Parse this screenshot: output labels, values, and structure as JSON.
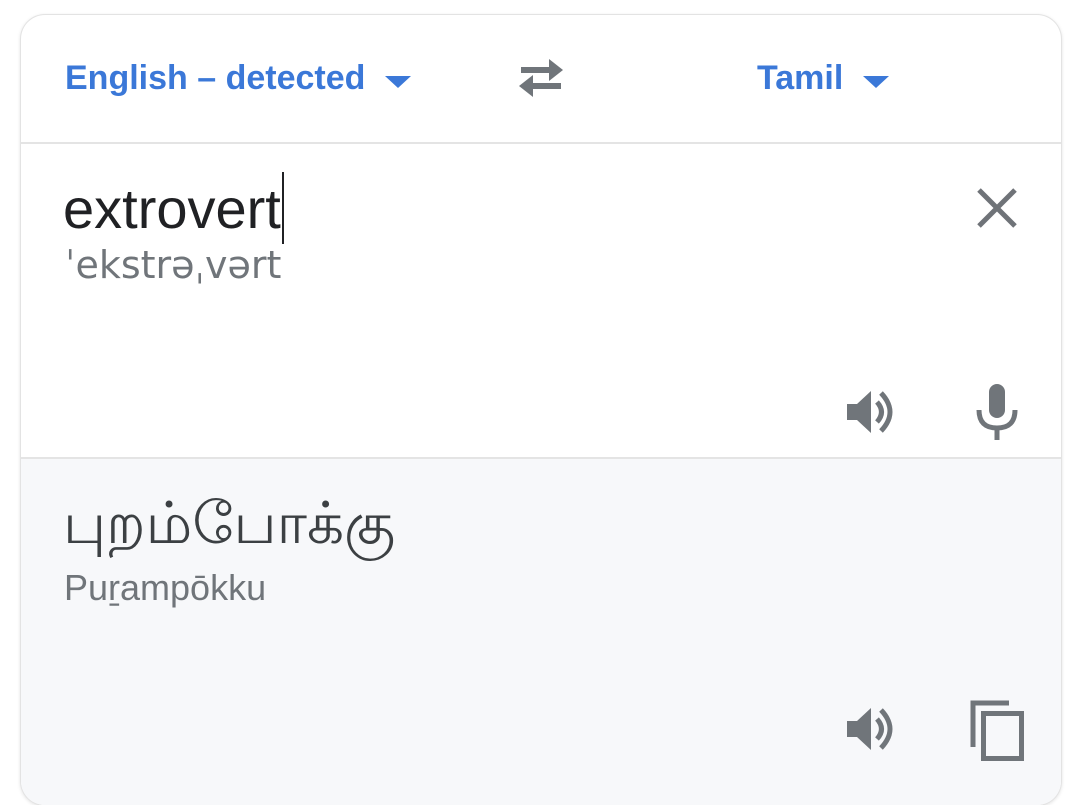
{
  "language_bar": {
    "source_language": "English – detected",
    "target_language": "Tamil"
  },
  "input": {
    "text": "extrovert",
    "phonetic": "ˈekstrəˌvərt"
  },
  "output": {
    "translation": "புறம்போக்கு",
    "transliteration": "Puṟampōkku"
  },
  "icons": {
    "dropdown": "caret-down-icon",
    "swap": "swap-arrows-icon",
    "clear": "close-icon",
    "speaker": "volume-icon",
    "mic": "microphone-icon",
    "copy": "copy-icon"
  },
  "colors": {
    "accent": "#3b78d8",
    "icon": "#70757a",
    "output_bg": "#f7f8fa"
  }
}
